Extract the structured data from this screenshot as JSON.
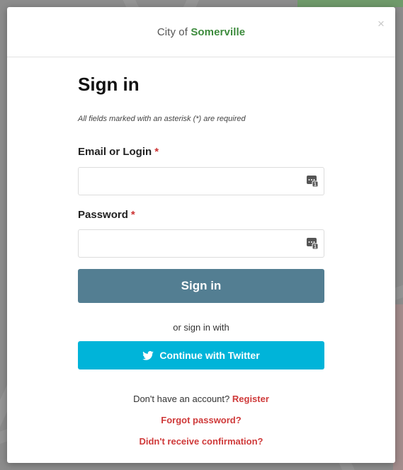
{
  "brand": {
    "prefix": "City of",
    "name": "Somerville"
  },
  "modal": {
    "close_glyph": "×"
  },
  "form": {
    "title": "Sign in",
    "required_note": "All fields marked with an asterisk (*) are required",
    "email": {
      "label": "Email or Login",
      "required_mark": "*",
      "value": "",
      "placeholder": ""
    },
    "password": {
      "label": "Password",
      "required_mark": "*",
      "value": "",
      "placeholder": ""
    },
    "submit_label": "Sign in",
    "or_text": "or sign in with",
    "twitter_label": "Continue with Twitter"
  },
  "footer": {
    "no_account_text": "Don't have an account?",
    "register_label": "Register",
    "forgot_label": "Forgot password?",
    "confirmation_label": "Didn't receive confirmation?"
  },
  "colors": {
    "accent_green": "#3d8b3d",
    "primary_button": "#537e92",
    "twitter_button": "#00b4d9",
    "link_red": "#cf3a3a"
  },
  "icons": [
    "close-icon",
    "password-manager-icon",
    "twitter-icon"
  ]
}
